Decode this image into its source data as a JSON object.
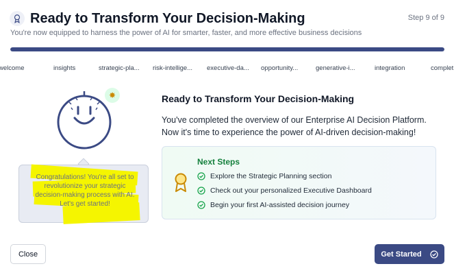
{
  "header": {
    "title": "Ready to Transform Your Decision-Making",
    "subtitle": "You're now equipped to harness the power of AI for smarter, faster, and more effective business decisions",
    "step_label": "Step 9 of 9",
    "icon": "award-icon"
  },
  "progress": {
    "value": 1.0,
    "color": "#3b4a84"
  },
  "steps": [
    "welcome",
    "insights",
    "strategic-pla...",
    "risk-intellige...",
    "executive-da...",
    "opportunity...",
    "generative-i...",
    "integration",
    "complet"
  ],
  "illustration": {
    "face": "smiley-face-icon",
    "sparkle": "sparkle-icon",
    "speech": "Congratulations! You're all set to revolutionize your strategic decision-making process with AI. Let's get started!"
  },
  "content": {
    "title": "Ready to Transform Your Decision-Making",
    "body": "You've completed the overview of our Enterprise AI Decision Platform. Now it's time to experience the power of AI-driven decision-making!"
  },
  "next_steps": {
    "title": "Next Steps",
    "items": [
      "Explore the Strategic Planning section",
      "Check out your personalized Executive Dashboard",
      "Begin your first AI-assisted decision journey"
    ],
    "accent": "#15803d"
  },
  "buttons": {
    "close": "Close",
    "get_started": "Get Started"
  },
  "colors": {
    "primary": "#3b4a84",
    "success": "#16a34a",
    "award": "#ca8a04"
  }
}
